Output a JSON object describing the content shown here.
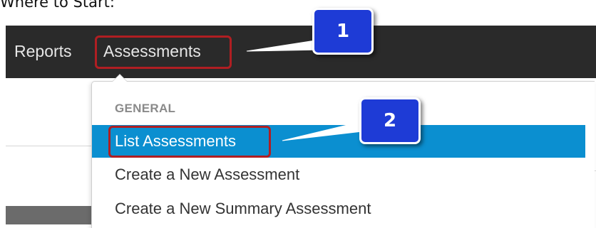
{
  "heading": "Where to Start:",
  "navbar": {
    "items": [
      {
        "label": "Reports"
      },
      {
        "label": "Assessments"
      }
    ]
  },
  "dropdown": {
    "section_header": "GENERAL",
    "items": [
      {
        "label": "List Assessments",
        "highlighted": true
      },
      {
        "label": "Create a New Assessment",
        "highlighted": false
      },
      {
        "label": "Create a New Summary Assessment",
        "highlighted": false
      }
    ]
  },
  "callouts": [
    {
      "label": "1"
    },
    {
      "label": "2"
    }
  ],
  "colors": {
    "navbar_bg": "#2a2a2a",
    "highlight_bg": "#0b8fd0",
    "callout_bg": "#1e3bd6",
    "annotation_red": "#b01e22"
  }
}
